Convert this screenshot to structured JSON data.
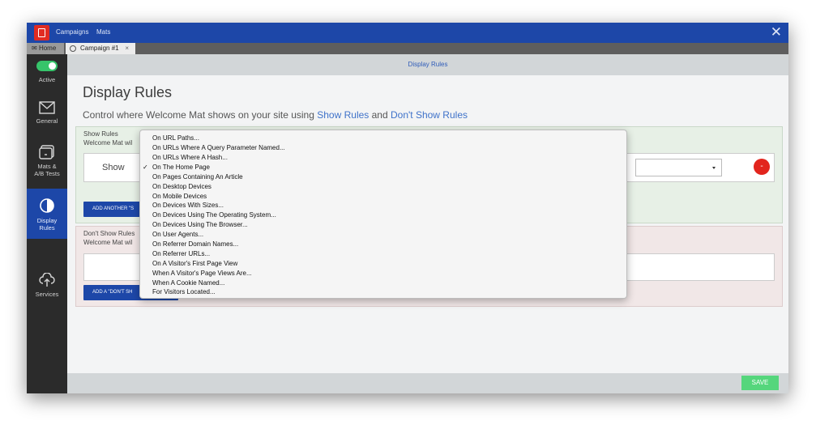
{
  "topnav": {
    "items": [
      "Campaigns",
      "Mats"
    ]
  },
  "tabs": {
    "home": "Home",
    "campaign": "Campaign #1",
    "close": "×"
  },
  "sidebar": {
    "active_label": "Active",
    "items": [
      "General",
      "Mats &",
      "A/B Tests",
      "Display",
      "Rules",
      "Services"
    ]
  },
  "header": {
    "title": "Display Rules"
  },
  "main": {
    "heading": "Display Rules",
    "subtitle_prefix": "Control where Welcome Mat shows on your site using ",
    "show_link": "Show Rules",
    "and": " and ",
    "dont_link": "Don't Show Rules"
  },
  "show_panel": {
    "title": "Show Rules",
    "desc": "Welcome Mat wil",
    "rule_label": "Show",
    "delete_label": "-",
    "add_button": "ADD ANOTHER \"S"
  },
  "dont_panel": {
    "title": "Don't Show Rules",
    "desc": "Welcome Mat wil",
    "add_button": "ADD A \"DON'T SH"
  },
  "footer": {
    "save": "SAVE"
  },
  "dropdown": {
    "selected_index": 3,
    "check": "✓",
    "options": [
      "On URL Paths...",
      "On URLs Where A Query Parameter Named...",
      "On URLs Where A Hash...",
      "On The Home Page",
      "On Pages Containing An Article",
      "On Desktop Devices",
      "On Mobile Devices",
      "On Devices With Sizes...",
      "On Devices Using The Operating System...",
      "On Devices Using The Browser...",
      "On User Agents...",
      "On Referrer Domain Names...",
      "On Referrer URLs...",
      "On A Visitor's First Page View",
      "When A Visitor's Page Views Are...",
      "When A Cookie Named...",
      "For Visitors Located..."
    ]
  },
  "colors": {
    "brand": "#1d47a8",
    "delete": "#e2251d",
    "save": "#55d67c",
    "active_toggle": "#36c46a"
  }
}
